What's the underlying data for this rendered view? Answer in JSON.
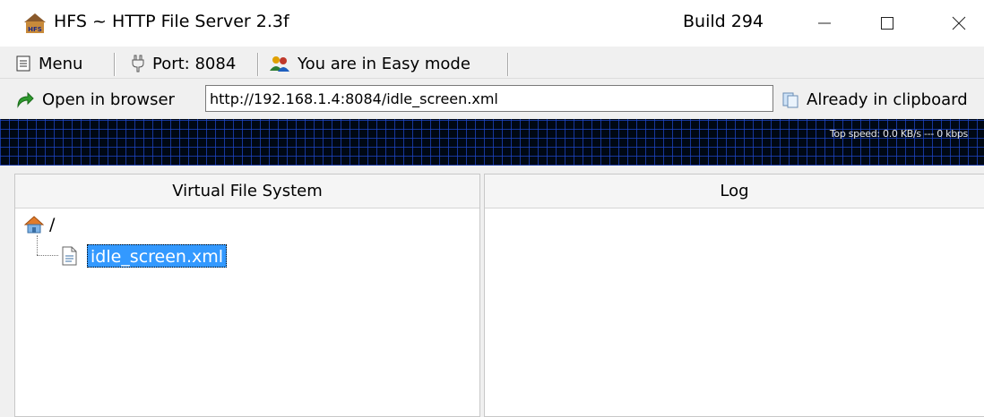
{
  "window": {
    "title": "HFS ~ HTTP File Server 2.3f",
    "build": "Build 294"
  },
  "toolbar": {
    "menu_label": "Menu",
    "port_label": "Port: 8084",
    "mode_label": "You are in Easy mode"
  },
  "address": {
    "open_browser_label": "Open in browser",
    "url": "http://192.168.1.4:8084/idle_screen.xml",
    "clipboard_label": "Already in clipboard"
  },
  "graph": {
    "speed_text": "Top speed: 0.0 KB/s --- 0 kbps"
  },
  "panels": {
    "vfs_title": "Virtual File System",
    "log_title": "Log"
  },
  "tree": {
    "root_label": "/",
    "file_label": "idle_screen.xml"
  },
  "colors": {
    "selection": "#3399ff",
    "graph_bg": "#000814",
    "graph_grid": "#1e46c8"
  }
}
